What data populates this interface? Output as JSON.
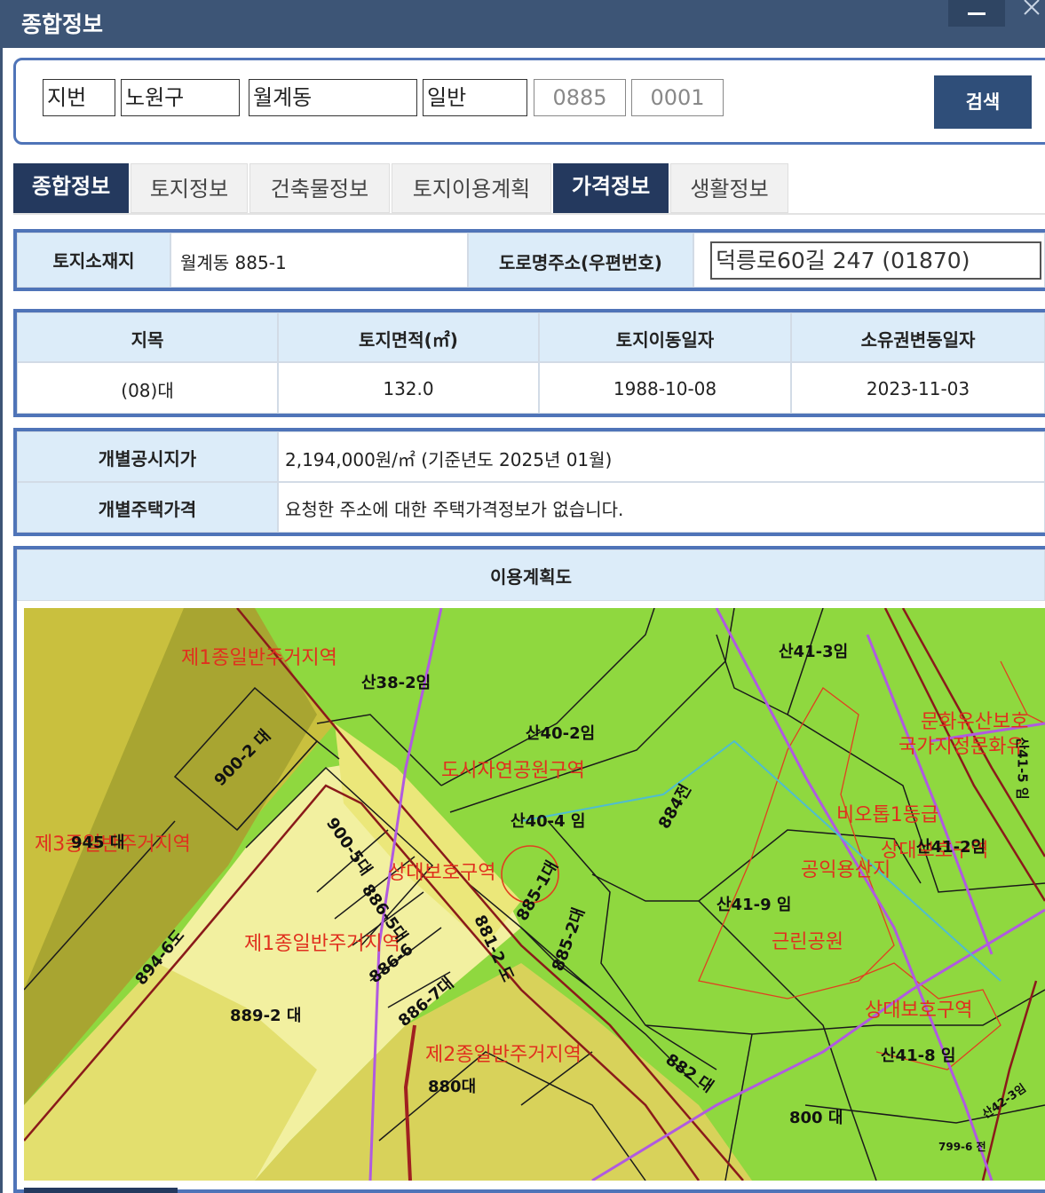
{
  "window": {
    "title": "종합정보",
    "minimize_label": "—"
  },
  "search": {
    "fields": [
      "지번",
      "노원구",
      "월계동",
      "일반",
      "0885",
      "0001"
    ],
    "button_label": "검색"
  },
  "tabs": [
    {
      "label": "종합정보",
      "active": true
    },
    {
      "label": "토지정보",
      "active": false
    },
    {
      "label": "건축물정보",
      "active": false
    },
    {
      "label": "토지이용계획",
      "active": false
    },
    {
      "label": "가격정보",
      "active": true
    },
    {
      "label": "생활정보",
      "active": false
    }
  ],
  "address": {
    "land_label": "토지소재지",
    "land_value": "월계동 885-1",
    "road_label": "도로명주소(우편번호)",
    "road_value": "덕릉로60길 247 (01870)"
  },
  "land_table": {
    "headers": [
      "지목",
      "토지면적(㎡)",
      "토지이동일자",
      "소유권변동일자"
    ],
    "values": [
      "(08)대",
      "132.0",
      "1988-10-08",
      "2023-11-03"
    ]
  },
  "price": {
    "land_label": "개별공시지가",
    "land_value": "2,194,000원/㎡ (기준년도 2025년 01월)",
    "house_label": "개별주택가격",
    "house_value": "요청한 주소에 대한 주택가격정보가 없습니다."
  },
  "plan_map": {
    "title": "이용계획도",
    "zone_labels": [
      "제1종일반주거지역",
      "도시자연공원구역",
      "문화유산보호",
      "국가지정문화유",
      "비오톱1등급",
      "상대보호구역",
      "공익용산지",
      "제3종일반주거지역",
      "상대보호구역",
      "제1종일반주거지역",
      "근린공원",
      "상대보호구역",
      "제2종일반주거지역"
    ],
    "parcel_labels": [
      "산38-2임",
      "산41-3임",
      "산40-2임",
      "900-2 대",
      "산40-4 임",
      "884전",
      "산41-2임",
      "945 대",
      "900-5대",
      "885-1대",
      "산41-9 임",
      "886-5대",
      "881-2 도",
      "885-2대",
      "894-6도",
      "886-6",
      "886-7대",
      "889-2 대",
      "882 대",
      "산41-8 임",
      "880대",
      "800 대",
      "산42-3임",
      "799-6 전",
      "산41-5 임"
    ]
  }
}
